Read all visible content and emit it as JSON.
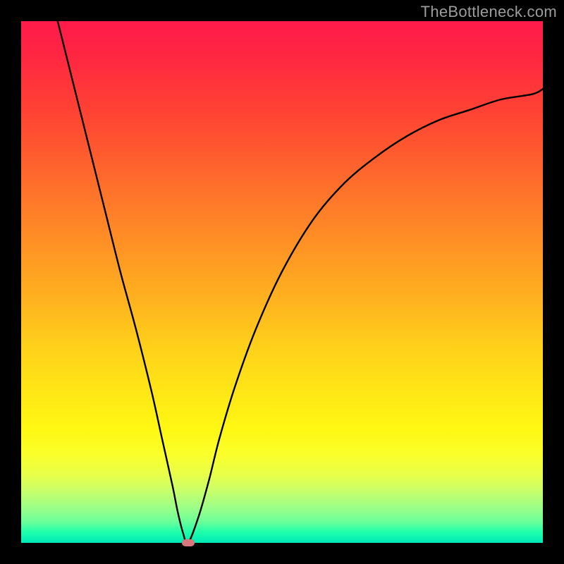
{
  "watermark": "TheBottleneck.com",
  "chart_data": {
    "type": "line",
    "title": "",
    "xlabel": "",
    "ylabel": "",
    "xlim": [
      0,
      100
    ],
    "ylim": [
      0,
      100
    ],
    "grid": false,
    "background_gradient": {
      "top_color": "#ff1a4b",
      "bottom_color": "#00e9b8"
    },
    "series": [
      {
        "name": "bottleneck-curve",
        "color": "#000000",
        "x": [
          7,
          10,
          13,
          16,
          19,
          22,
          25,
          27,
          29,
          30,
          31,
          32,
          34,
          36,
          38,
          41,
          45,
          50,
          56,
          62,
          68,
          74,
          80,
          86,
          92,
          98,
          100
        ],
        "y": [
          100,
          88,
          76,
          64,
          52,
          41,
          29,
          20,
          11,
          6,
          2,
          0,
          5,
          12,
          20,
          30,
          41,
          52,
          62,
          69,
          74,
          78,
          81,
          83,
          85,
          86,
          87
        ]
      }
    ],
    "marker": {
      "name": "optimal-point",
      "x": 32,
      "y": 0,
      "color": "#d9777e"
    }
  }
}
